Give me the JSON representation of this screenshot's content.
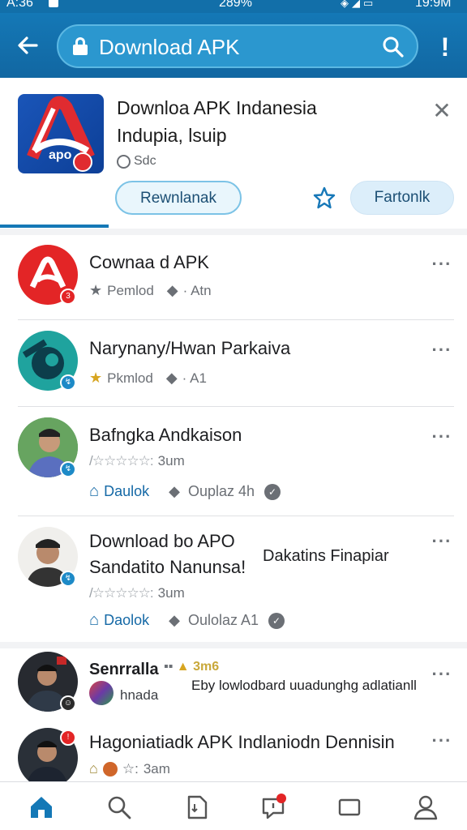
{
  "status_bar": {
    "time": "A:36",
    "battery_pct": "289%",
    "clock": "19:9M"
  },
  "app_bar": {
    "search_value": "Download APK"
  },
  "feature": {
    "title": "Downloa APK Indanesia",
    "subtitle": "Indupia, lsuip",
    "meta": "Sdc",
    "logo_text": "apo",
    "primary_button": "Rewnlanak",
    "secondary_button": "Fartonlk"
  },
  "list": [
    {
      "title": "Cownaa d APK",
      "rating_label": "Pemlod",
      "comment_label": "· Atn"
    },
    {
      "title": "Narynany/Hwan Parkaiva",
      "rating_label": "Pkmlod",
      "comment_label": "· A1"
    },
    {
      "title": "Bafngka Andkaison",
      "rating": "3um",
      "action_label": "Daulok",
      "comment_label": "Ouplaz 4h"
    },
    {
      "title_line1": "Download bo APO",
      "title_line2": "Sandatito Nanunsa!",
      "side_label": "Dakatins Finapiar",
      "rating": "3um",
      "action_label": "Daolok",
      "comment_label": "Oulolaz A1"
    }
  ],
  "list2": [
    {
      "name": "Senrralla",
      "badge": "3m6",
      "text": "Eby lowlodbard uuadunghg adlatianll",
      "sub": "hnada"
    },
    {
      "title": "Hagoniatiadk APK Indlaniodn Dennisin",
      "rating": "3am"
    }
  ],
  "colors": {
    "primary": "#1478b6",
    "accent_red": "#e02222",
    "star_gold": "#d7a521"
  },
  "icons": [
    "back-arrow-icon",
    "lock-icon",
    "search-icon",
    "more-vert-icon",
    "close-icon",
    "star-outline-icon",
    "home-icon",
    "comment-icon",
    "chevron-circle-icon",
    "search-nav-icon",
    "document-icon",
    "notification-icon",
    "square-icon",
    "profile-icon"
  ]
}
